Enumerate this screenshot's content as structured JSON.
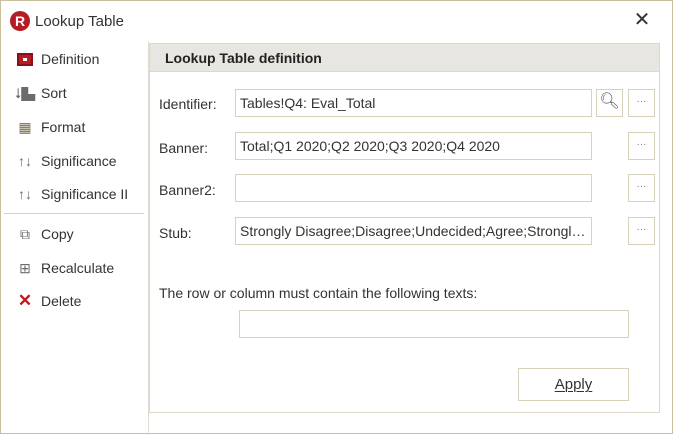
{
  "window": {
    "title": "Lookup Table",
    "close_icon": "close-icon"
  },
  "sidebar": {
    "items": [
      {
        "label": "Definition",
        "icon": "definition-icon"
      },
      {
        "label": "Sort",
        "icon": "sort-icon"
      },
      {
        "label": "Format",
        "icon": "format-grid-icon"
      },
      {
        "label": "Significance",
        "icon": "significance-arrows-icon"
      },
      {
        "label": "Significance II",
        "icon": "significance-arrows-icon"
      },
      {
        "label": "Copy",
        "icon": "copy-icon"
      },
      {
        "label": "Recalculate",
        "icon": "calculator-icon"
      },
      {
        "label": "Delete",
        "icon": "delete-x-icon"
      }
    ]
  },
  "panel": {
    "title": "Lookup Table definition",
    "identifier": {
      "label": "Identifier:",
      "value": "Tables!Q4: Eval_Total"
    },
    "banner": {
      "label": "Banner:",
      "value": "Total;Q1 2020;Q2 2020;Q3 2020;Q4 2020"
    },
    "banner2": {
      "label": "Banner2:",
      "value": ""
    },
    "stub": {
      "label": "Stub:",
      "value": "Strongly Disagree;Disagree;Undecided;Agree;Strongly Agree"
    },
    "ellipsis": "···",
    "note": "The row or column must contain the following texts:",
    "texts_value": "",
    "apply": "Apply"
  },
  "colors": {
    "accent": "#b51c24",
    "border": "#d9d2bb"
  }
}
